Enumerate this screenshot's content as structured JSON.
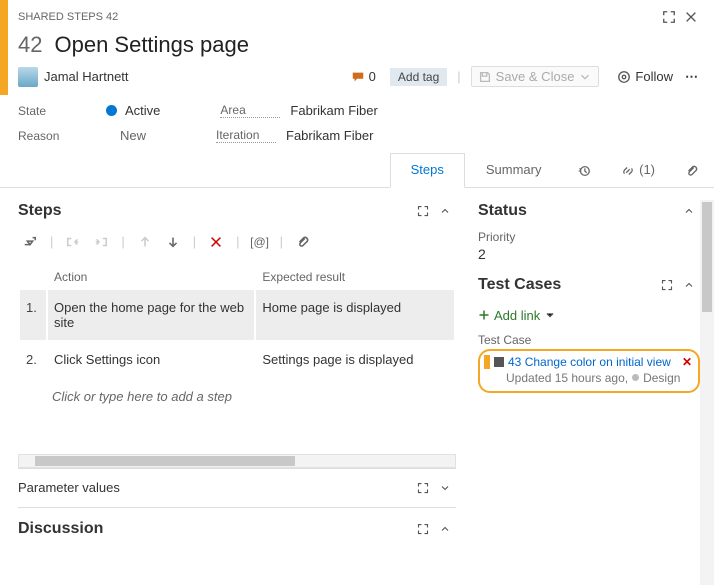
{
  "header": {
    "breadcrumb": "SHARED STEPS 42",
    "id": "42",
    "title": "Open Settings page",
    "assignee": "Jamal Hartnett",
    "discussion_count": "0",
    "add_tag": "Add tag",
    "save": "Save & Close",
    "follow": "Follow"
  },
  "fields": {
    "state_label": "State",
    "state_value": "Active",
    "area_label": "Area",
    "area_value": "Fabrikam Fiber",
    "reason_label": "Reason",
    "reason_value": "New",
    "iteration_label": "Iteration",
    "iteration_value": "Fabrikam Fiber"
  },
  "tabs": {
    "steps": "Steps",
    "summary": "Summary",
    "links_count": "(1)"
  },
  "steps": {
    "title": "Steps",
    "col_action": "Action",
    "col_expected": "Expected result",
    "rows": [
      {
        "n": "1.",
        "action": "Open the home page for the web site",
        "expected": "Home page is displayed"
      },
      {
        "n": "2.",
        "action": "Click Settings icon",
        "expected": "Settings page is displayed"
      }
    ],
    "ghost": "Click or type here to add a step",
    "param_values": "Parameter values"
  },
  "discussion": {
    "title": "Discussion"
  },
  "status": {
    "title": "Status",
    "priority_label": "Priority",
    "priority_value": "2"
  },
  "testcases": {
    "title": "Test Cases",
    "add_link": "Add link",
    "tc_label": "Test Case",
    "item": {
      "id": "43",
      "title": "Change color on initial view",
      "updated": "Updated 15 hours ago,",
      "state": "Design"
    }
  }
}
